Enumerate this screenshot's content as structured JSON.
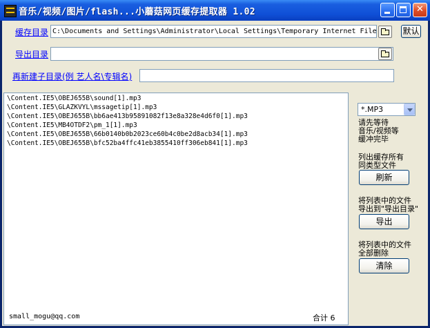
{
  "window": {
    "title": "音乐/视频/图片/flash...小蘑菇网页缓存提取器 1.02"
  },
  "titlebar": {
    "minimize_icon": "minimize-icon",
    "maximize_icon": "maximize-icon",
    "close_glyph": "✕"
  },
  "cache_dir": {
    "label": "缓存目录",
    "value": "C:\\Documents and Settings\\Administrator\\Local Settings\\Temporary Internet Files",
    "default_label": "默认"
  },
  "export_dir": {
    "label": "导出目录",
    "value": ""
  },
  "subdir": {
    "label": "再新建子目录(例 艺人名\\专辑名)",
    "value": ""
  },
  "file_list": [
    "\\Content.IE5\\OBEJ655B\\sound[1].mp3",
    "\\Content.IE5\\GLAZKVYL\\mssagetip[1].mp3",
    "\\Content.IE5\\OBEJ655B\\bb6ae413b95891082f13e8a328e4d6f0[1].mp3",
    "\\Content.IE5\\MB4OTDF2\\pm_1[1].mp3",
    "\\Content.IE5\\OBEJ655B\\66b0140b0b2023ce60b4c0be2d8acb34[1].mp3",
    "\\Content.IE5\\OBEJ655B\\bfc52ba4ffc41eb3855410ff306eb841[1].mp3"
  ],
  "status": {
    "email": "small_mogu@qq.com",
    "total": "合计 6"
  },
  "side": {
    "filetype": "*.MP3",
    "wait_hint": "请先等待\n音乐/视频等\n缓冲完毕",
    "refresh_hint": "列出缓存所有\n同类型文件",
    "refresh_label": "刷新",
    "export_hint": "将列表中的文件\n导出到\"导出目录\"",
    "export_label": "导出",
    "delete_hint": "将列表中的文件\n全部删除",
    "delete_label": "清除"
  }
}
